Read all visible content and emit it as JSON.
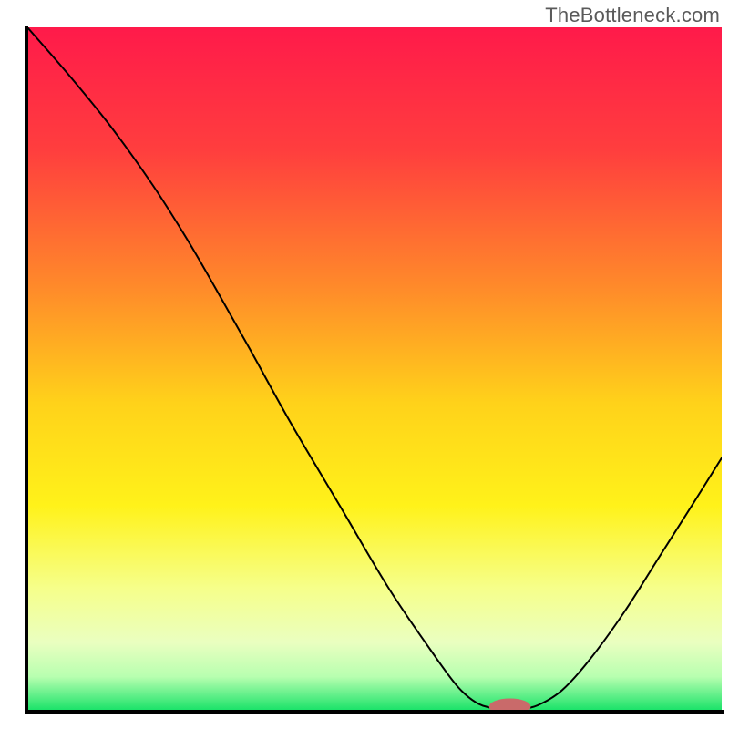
{
  "watermark": "TheBottleneck.com",
  "chart_data": {
    "type": "line",
    "title": "",
    "xlabel": "",
    "ylabel": "",
    "xlim": [
      0,
      100
    ],
    "ylim": [
      0,
      100
    ],
    "gradient_stops": [
      {
        "offset": 0.0,
        "color": "#ff1a4a"
      },
      {
        "offset": 0.18,
        "color": "#ff3e3e"
      },
      {
        "offset": 0.38,
        "color": "#ff8a2a"
      },
      {
        "offset": 0.55,
        "color": "#ffd21a"
      },
      {
        "offset": 0.7,
        "color": "#fff21a"
      },
      {
        "offset": 0.82,
        "color": "#f6ff8a"
      },
      {
        "offset": 0.9,
        "color": "#eaffc0"
      },
      {
        "offset": 0.95,
        "color": "#b8ffb0"
      },
      {
        "offset": 1.0,
        "color": "#18e268"
      }
    ],
    "curve": [
      {
        "x": 0.0,
        "y": 100.0
      },
      {
        "x": 6.0,
        "y": 93.0
      },
      {
        "x": 12.0,
        "y": 85.5
      },
      {
        "x": 18.0,
        "y": 77.0
      },
      {
        "x": 23.0,
        "y": 69.0
      },
      {
        "x": 27.0,
        "y": 62.0
      },
      {
        "x": 32.0,
        "y": 53.0
      },
      {
        "x": 38.0,
        "y": 42.0
      },
      {
        "x": 45.0,
        "y": 30.0
      },
      {
        "x": 52.0,
        "y": 18.0
      },
      {
        "x": 58.0,
        "y": 9.0
      },
      {
        "x": 62.0,
        "y": 3.5
      },
      {
        "x": 65.0,
        "y": 1.0
      },
      {
        "x": 68.0,
        "y": 0.3
      },
      {
        "x": 71.0,
        "y": 0.3
      },
      {
        "x": 73.5,
        "y": 0.8
      },
      {
        "x": 77.0,
        "y": 3.0
      },
      {
        "x": 81.0,
        "y": 7.5
      },
      {
        "x": 86.0,
        "y": 14.5
      },
      {
        "x": 91.0,
        "y": 22.5
      },
      {
        "x": 96.0,
        "y": 30.5
      },
      {
        "x": 100.0,
        "y": 37.0
      }
    ],
    "marker": {
      "x": 69.5,
      "y": 0.6,
      "rx": 3.0,
      "ry": 1.2,
      "color": "#c96a6a"
    },
    "axis_color": "#000000",
    "curve_color": "#000000",
    "curve_width": 2
  }
}
